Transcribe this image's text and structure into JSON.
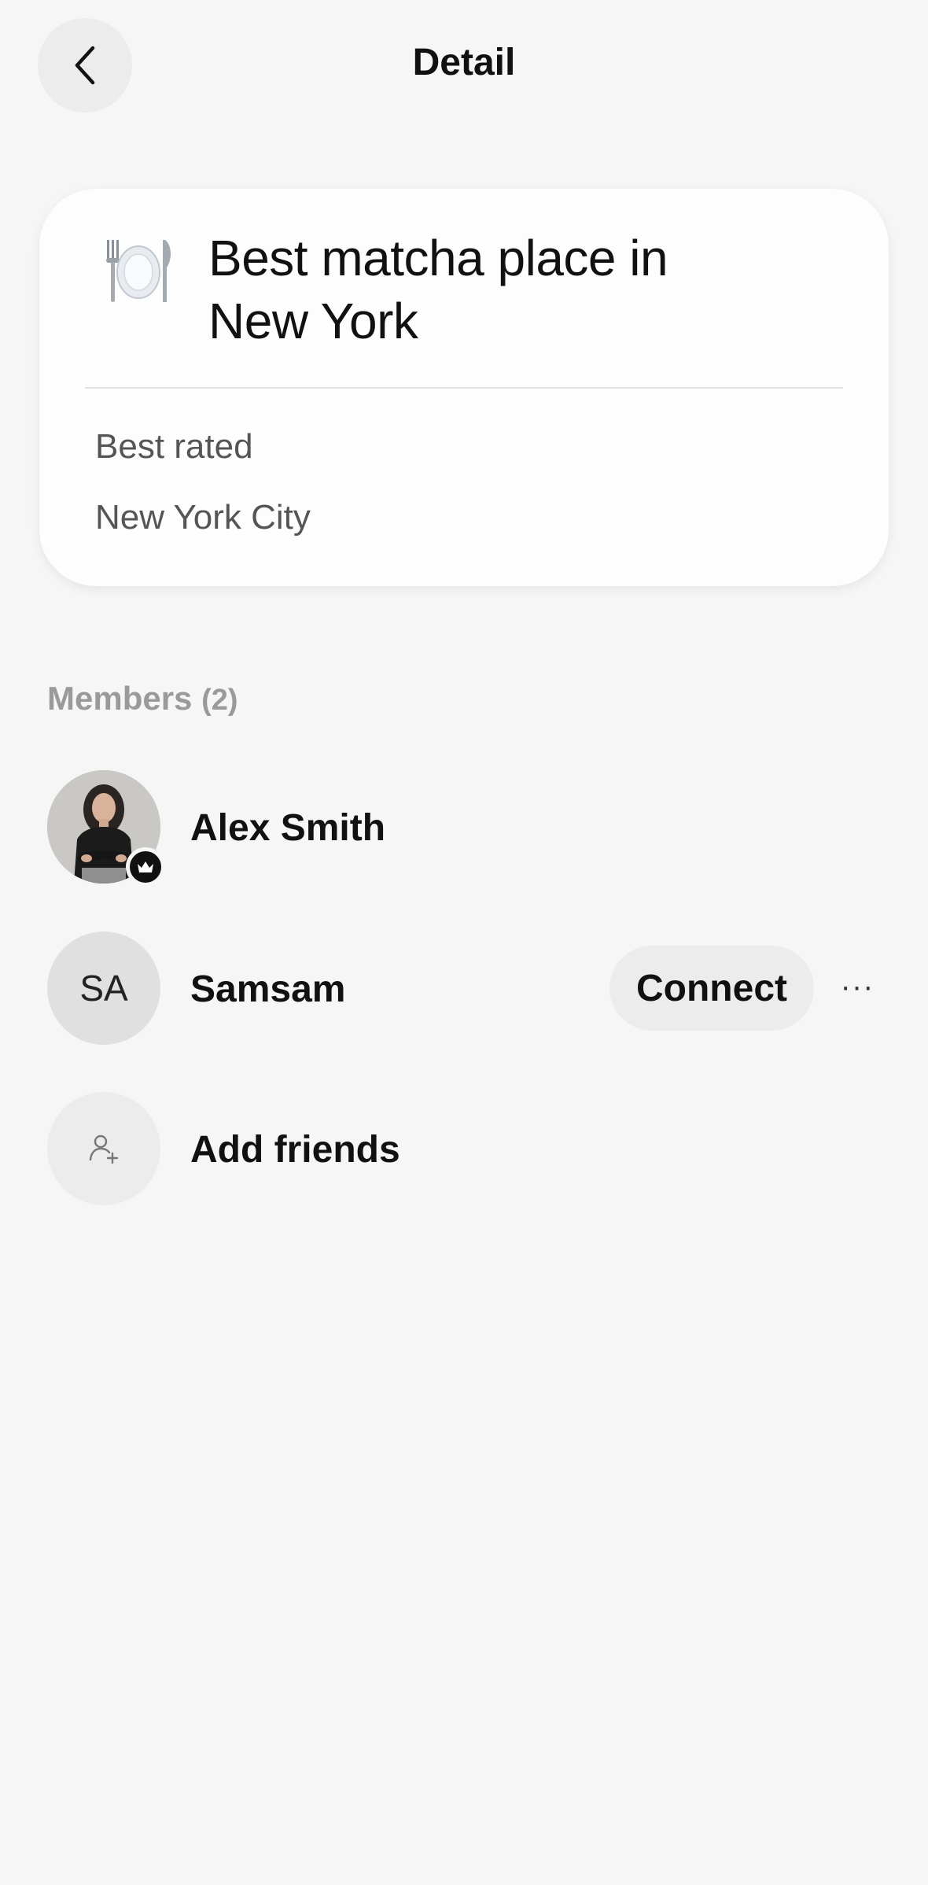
{
  "header": {
    "title": "Detail",
    "back_icon": "chevron-left-icon"
  },
  "card": {
    "emoji": "🍽️",
    "title_line1": "Best matcha place in",
    "title_line2": "New York",
    "line1": "Best rated",
    "line2": "New York City"
  },
  "members": {
    "heading": "Members",
    "count": "(2)",
    "list": [
      {
        "name": "Alex Smith",
        "avatar_type": "photo",
        "badge_icon": "crown-icon"
      },
      {
        "name": "Samsam",
        "initials": "SA",
        "action_label": "Connect",
        "more_label": "···"
      }
    ],
    "add_friends_label": "Add friends",
    "add_icon": "user-plus-icon"
  },
  "colors": {
    "background": "#f6f6f6",
    "card": "#fdfdfd",
    "muted": "#9a9a9a",
    "button_bg": "#ececec"
  }
}
